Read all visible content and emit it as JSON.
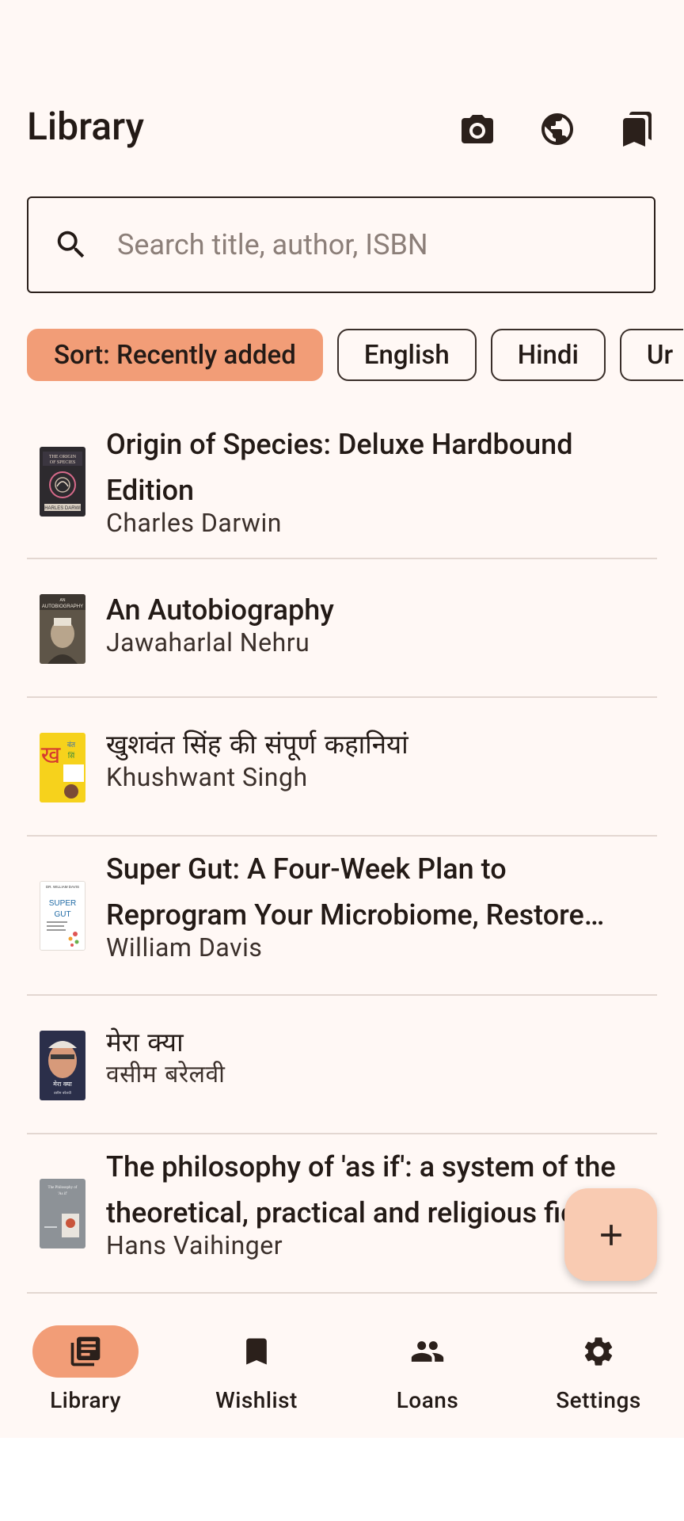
{
  "app": {
    "title": "Library"
  },
  "toolbar": {
    "icons": [
      "camera-icon",
      "globe-icon",
      "bookmarks-icon"
    ]
  },
  "search": {
    "placeholder": "Search title, author, ISBN",
    "value": ""
  },
  "filters": {
    "chips": [
      {
        "label": "Sort: Recently added",
        "selected": true
      },
      {
        "label": "English",
        "selected": false
      },
      {
        "label": "Hindi",
        "selected": false
      },
      {
        "label": "Ur",
        "selected": false
      }
    ]
  },
  "books": [
    {
      "title": "Origin of Species: Deluxe Hardbound Edition",
      "author": "Charles Darwin",
      "cover": "origin-of-species-cover"
    },
    {
      "title": "An Autobiography",
      "author": "Jawaharlal Nehru",
      "cover": "autobiography-cover"
    },
    {
      "title": "खुशवंत सिंह की संपूर्ण कहानियां",
      "author": "Khushwant Singh",
      "cover": "khushwant-cover"
    },
    {
      "title": "Super Gut: A Four-Week Plan to Reprogram Your Microbiome, Restore Health, and Lose Weight",
      "author": "William Davis",
      "cover": "super-gut-cover"
    },
    {
      "title": "मेरा क्या",
      "author": "वसीम बरेलवी",
      "cover": "mera-kya-cover"
    },
    {
      "title": "The philosophy of 'as if': a system of the theoretical, practical and religious fictions of mankind",
      "author": "Hans Vaihinger",
      "cover": "philosophy-as-if-cover"
    }
  ],
  "fab": {
    "icon": "plus-icon"
  },
  "bottom_nav": {
    "items": [
      {
        "label": "Library",
        "icon": "library-icon",
        "active": true
      },
      {
        "label": "Wishlist",
        "icon": "bookmark-icon",
        "active": false
      },
      {
        "label": "Loans",
        "icon": "people-icon",
        "active": false
      },
      {
        "label": "Settings",
        "icon": "gear-icon",
        "active": false
      }
    ]
  },
  "colors": {
    "background": "#fff8f5",
    "accent": "#f29d77",
    "fab": "#f9cbb2",
    "text": "#231a16"
  }
}
